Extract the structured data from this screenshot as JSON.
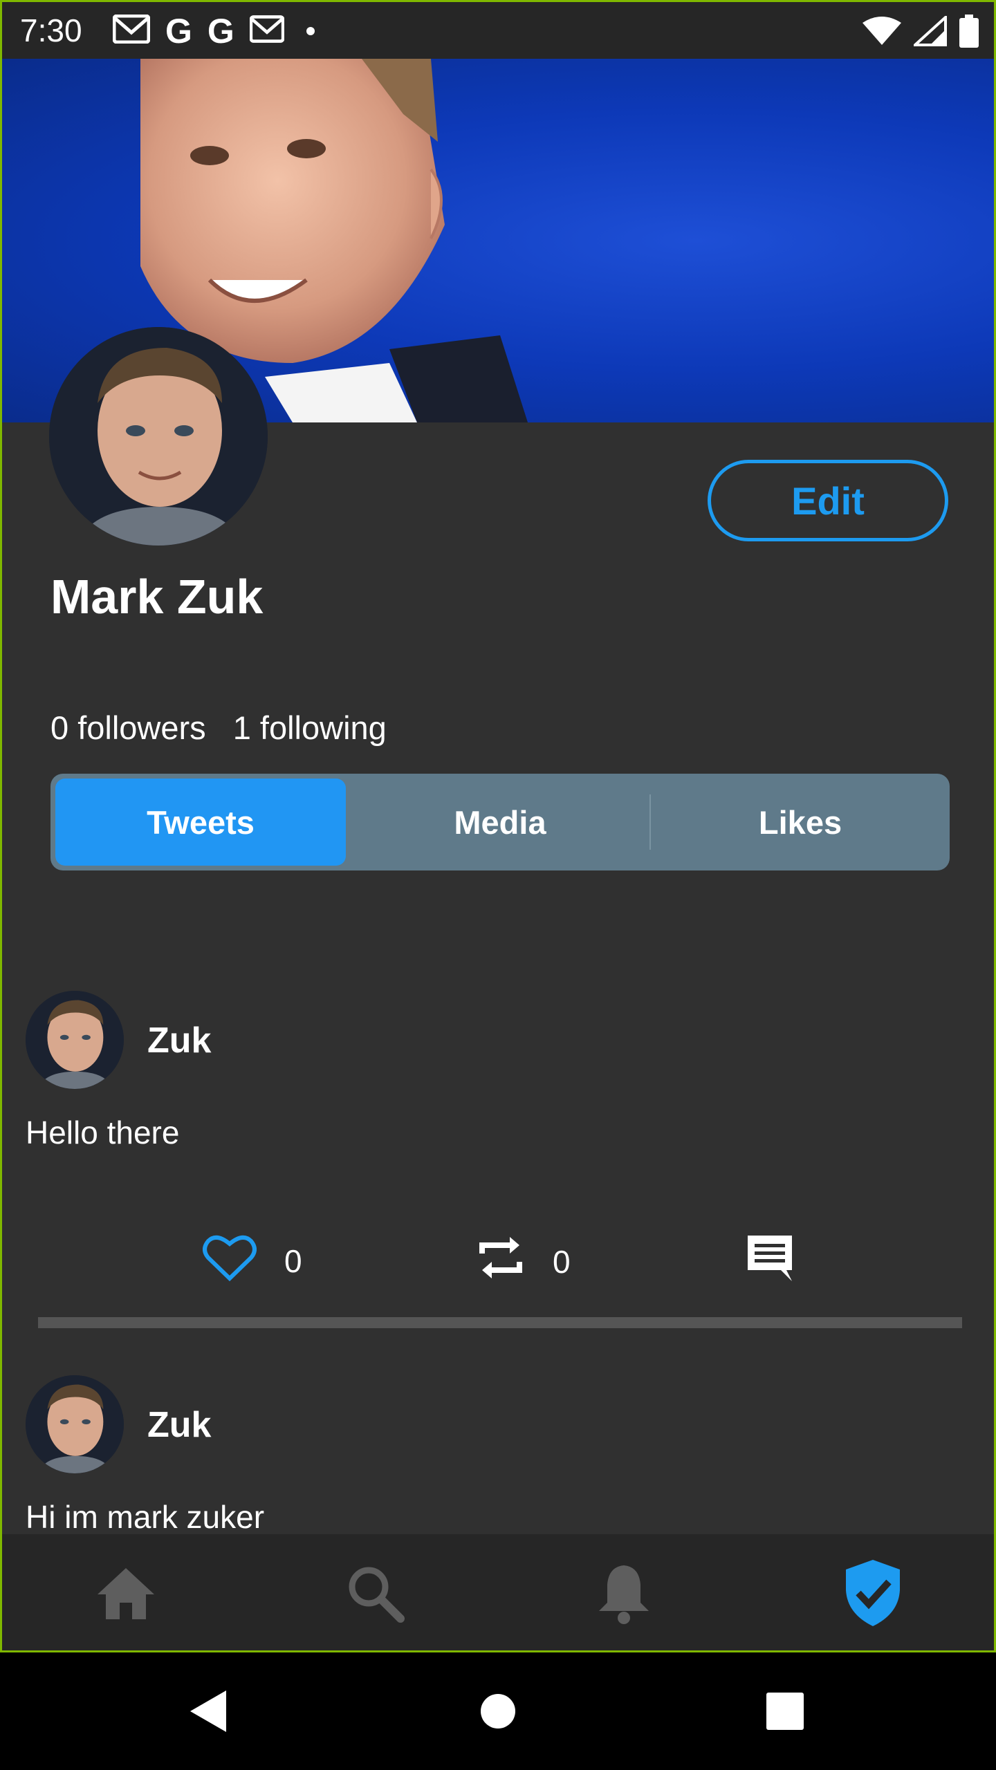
{
  "status_bar": {
    "time": "7:30",
    "left_icons": [
      "gmail-icon",
      "google-icon",
      "google-icon",
      "gmail-icon",
      "dot-icon"
    ],
    "right_icons": [
      "wifi-icon",
      "signal-icon",
      "battery-icon"
    ],
    "google_glyph": "G"
  },
  "profile": {
    "name": "Mark Zuk",
    "followers": "0 followers",
    "following": "1 following",
    "edit_label": "Edit"
  },
  "tabs": [
    {
      "label": "Tweets",
      "active": true
    },
    {
      "label": "Media",
      "active": false
    },
    {
      "label": "Likes",
      "active": false
    }
  ],
  "tweets": [
    {
      "author": "Zuk",
      "text": "Hello there",
      "likes": "0",
      "retweets": "0"
    },
    {
      "author": "Zuk",
      "text": "Hi im mark zuker"
    }
  ],
  "bottom_nav": [
    "home-icon",
    "search-icon",
    "bell-icon",
    "verified-shield-icon"
  ],
  "colors": {
    "accent": "#1d9bf0",
    "background": "#303030",
    "tabs_bg": "#5f7a8a",
    "active_tab": "#2196f3"
  }
}
